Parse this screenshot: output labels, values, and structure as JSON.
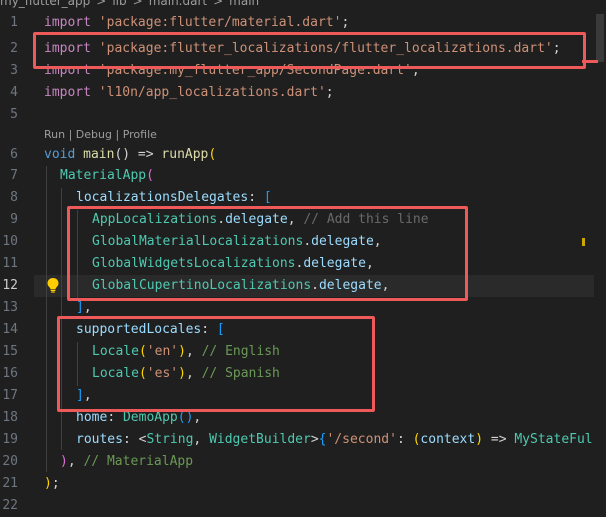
{
  "breadcrumb": {
    "items": [
      "my_flutter_app",
      ">",
      "lib",
      ">",
      "main.dart",
      ">",
      "main"
    ]
  },
  "codelens": {
    "run": "Run",
    "sep1": " | ",
    "debug": "Debug",
    "sep2": " | ",
    "profile": "Profile"
  },
  "line_numbers": [
    "1",
    "2",
    "3",
    "4",
    "5",
    "6",
    "7",
    "8",
    "9",
    "10",
    "11",
    "12",
    "13",
    "14",
    "15",
    "16",
    "17",
    "18",
    "19",
    "20",
    "21",
    "22"
  ],
  "active_line": "12",
  "code": {
    "l1": {
      "kw": "import",
      "str": "'package:flutter/material.dart'",
      "end": ";"
    },
    "l2": {
      "kw": "import",
      "str": "'package:flutter_localizations/flutter_localizations.dart'",
      "end": ";"
    },
    "l3": {
      "kw": "import",
      "str": "'package:my_flutter_app/SecondPage.dart'",
      "end": ";"
    },
    "l4": {
      "kw": "import",
      "str": "'l10n/app_localizations.dart'",
      "end": ";"
    },
    "l6": {
      "kw": "void",
      "fn": "main",
      "mid": "() => ",
      "fn2": "runApp",
      "br": "("
    },
    "l7": {
      "cls": "MaterialApp",
      "br": "("
    },
    "l8": {
      "prop": "localizationsDelegates",
      "colon": ": ",
      "br": "["
    },
    "l9": {
      "cls": "AppLocalizations",
      "dot": ".",
      "prop": "delegate",
      "comma": ", ",
      "com": "// Add this line"
    },
    "l10": {
      "cls": "GlobalMaterialLocalizations",
      "dot": ".",
      "prop": "delegate",
      "comma": ","
    },
    "l11": {
      "cls": "GlobalWidgetsLocalizations",
      "dot": ".",
      "prop": "delegate",
      "comma": ","
    },
    "l12": {
      "cls": "GlobalCupertinoLocalizations",
      "dot": ".",
      "prop": "delegate",
      "comma": ","
    },
    "l13": {
      "br": "]",
      "comma": ","
    },
    "l14": {
      "prop": "supportedLocales",
      "colon": ": ",
      "br": "["
    },
    "l15": {
      "cls": "Locale",
      "br1": "(",
      "str": "'en'",
      "br2": ")",
      "comma": ", ",
      "com": "// English"
    },
    "l16": {
      "cls": "Locale",
      "br1": "(",
      "str": "'es'",
      "br2": ")",
      "comma": ", ",
      "com": "// Spanish"
    },
    "l17": {
      "br": "]",
      "comma": ","
    },
    "l18": {
      "prop": "home",
      "colon": ": ",
      "cls": "DemoApp",
      "br": "()",
      "comma": ","
    },
    "l19": {
      "prop": "routes",
      "colon": ": ",
      "lt": "<",
      "cls1": "String",
      "c": ", ",
      "cls2": "WidgetBuilder",
      "gt": ">",
      "br": "{",
      "str": "'/second'",
      "colon2": ": ",
      "br2": "(",
      "ctx": "context",
      "br3": ")",
      "arrow": " => ",
      "cls3": "MyStateFul"
    },
    "l20": {
      "br": ")",
      "comma": ", ",
      "com": "// MaterialApp"
    },
    "l21": {
      "br": ")",
      "end": ";"
    }
  }
}
